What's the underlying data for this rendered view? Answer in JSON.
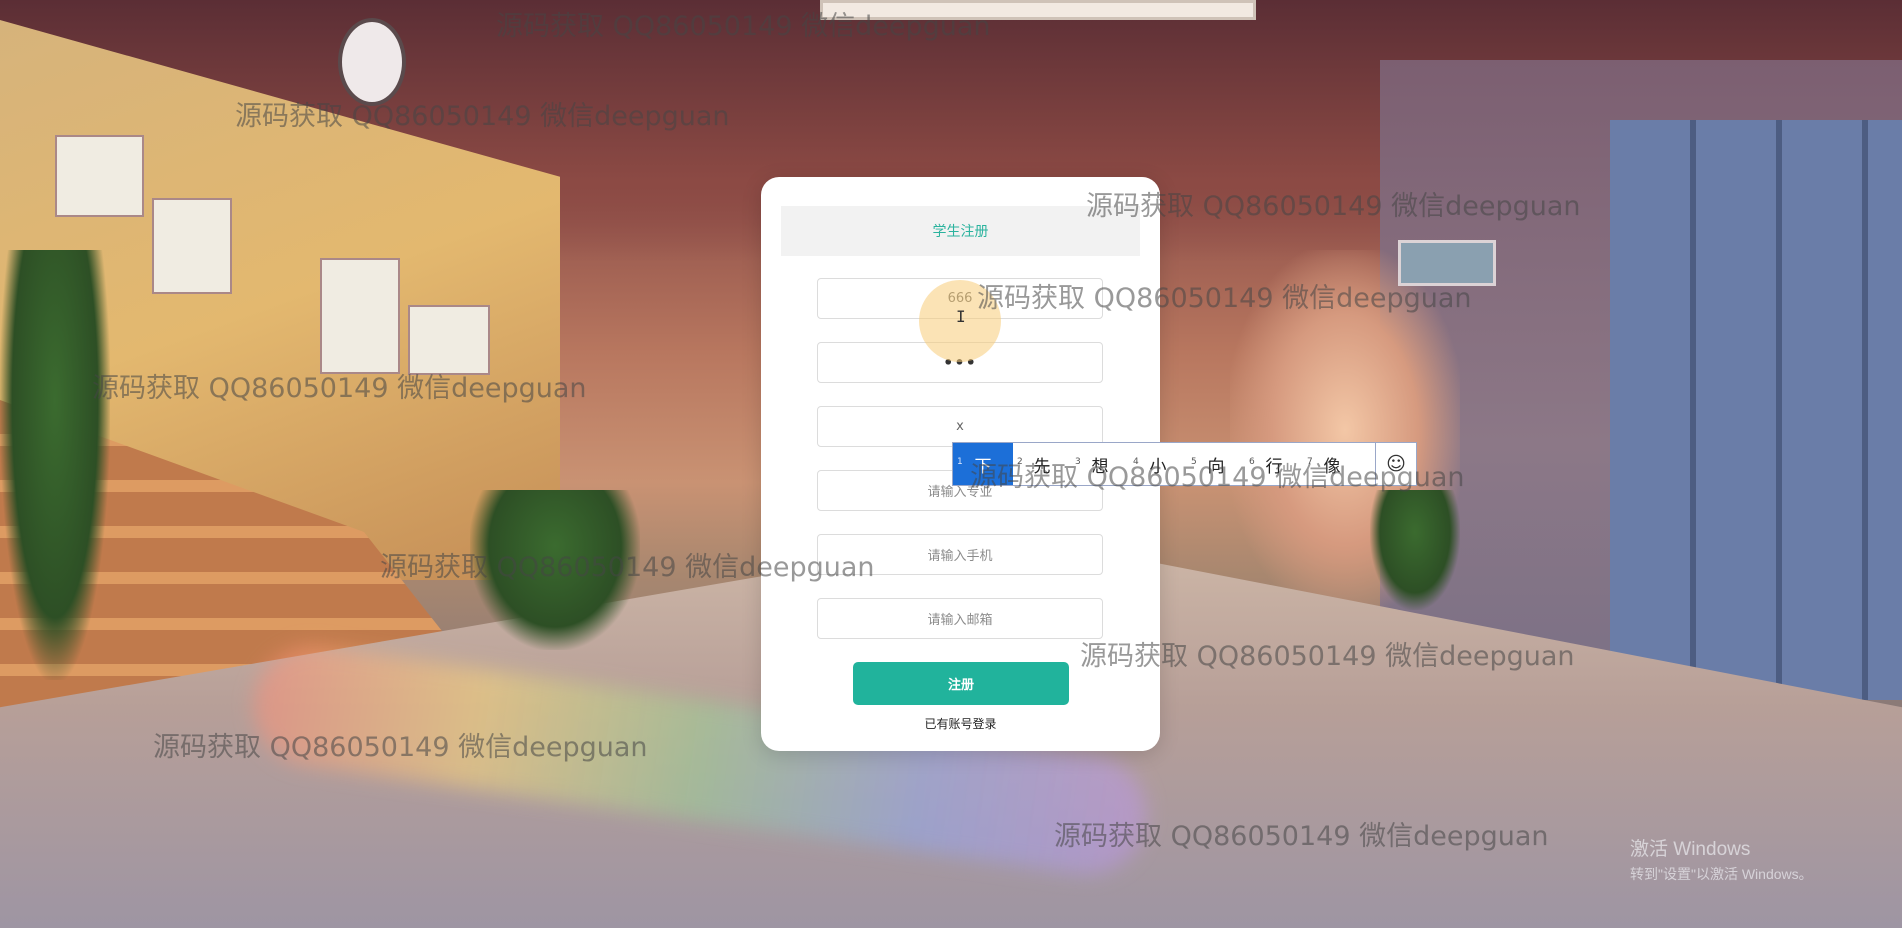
{
  "register": {
    "title": "学生注册",
    "fields": [
      {
        "name": "username",
        "value": "666",
        "placeholder": ""
      },
      {
        "name": "password",
        "value": "•••",
        "placeholder": ""
      },
      {
        "name": "name",
        "value": "x",
        "placeholder": ""
      },
      {
        "name": "major",
        "value": "",
        "placeholder": "请输入专业"
      },
      {
        "name": "phone",
        "value": "",
        "placeholder": "请输入手机"
      },
      {
        "name": "email",
        "value": "",
        "placeholder": "请输入邮箱"
      }
    ],
    "submit_label": "注册",
    "login_link": "已有账号登录",
    "accent_color": "#21b39c"
  },
  "ime": {
    "candidates": [
      {
        "num": "1",
        "text": "下"
      },
      {
        "num": "2",
        "text": "先"
      },
      {
        "num": "3",
        "text": "想"
      },
      {
        "num": "4",
        "text": "小"
      },
      {
        "num": "5",
        "text": "向"
      },
      {
        "num": "6",
        "text": "行"
      },
      {
        "num": "7",
        "text": "像"
      }
    ],
    "emoji_icon": "smiley-icon",
    "selected_color": "#1c6fd8"
  },
  "watermark_text": "源码获取 QQ86050149 微信deepguan",
  "system_overlay": {
    "line1": "激活 Windows",
    "line2": "转到\"设置\"以激活 Windows。"
  }
}
